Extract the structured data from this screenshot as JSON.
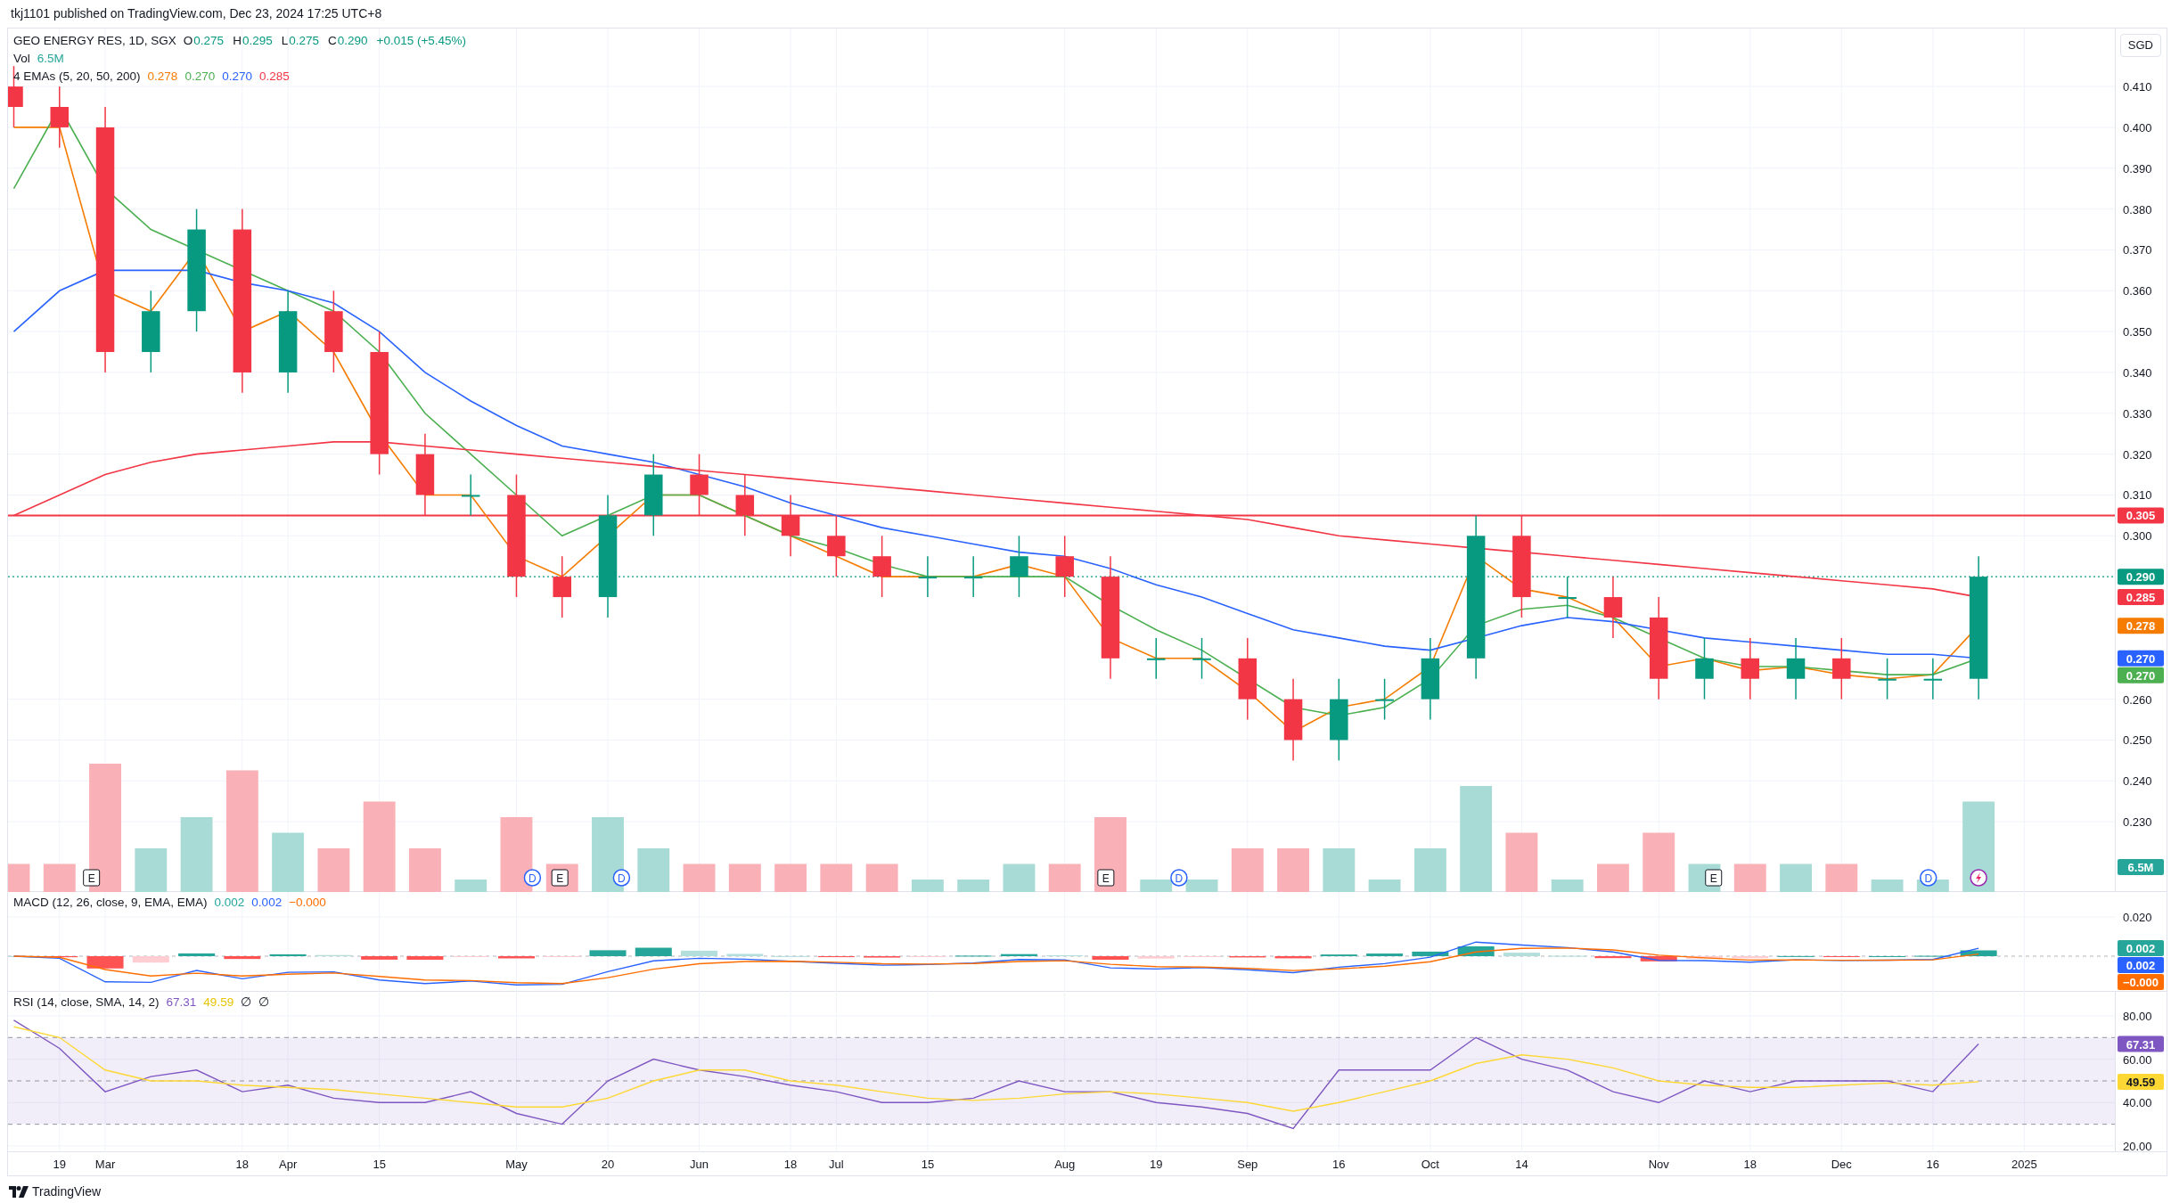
{
  "header": {
    "text": "tkj1101 published on TradingView.com, Dec 23, 2024 17:25 UTC+8"
  },
  "currency_button": "SGD",
  "legend": {
    "symbol": "GEO ENERGY RES, 1D, SGX",
    "ohlc": [
      {
        "key": "O",
        "value": "0.275"
      },
      {
        "key": "H",
        "value": "0.295"
      },
      {
        "key": "L",
        "value": "0.275"
      },
      {
        "key": "C",
        "value": "0.290"
      }
    ],
    "change": "+0.015 (+5.45%)",
    "volume_label": "Vol",
    "volume_value": "6.5M",
    "ema_label": "4 EMAs (5, 20, 50, 200)",
    "ema_values": [
      {
        "text": "0.278",
        "color": "#f57c00"
      },
      {
        "text": "0.270",
        "color": "#4caf50"
      },
      {
        "text": "0.270",
        "color": "#2962ff"
      },
      {
        "text": "0.285",
        "color": "#f23645"
      }
    ]
  },
  "price_pane": {
    "axis_ticks": [
      "0.410",
      "0.400",
      "0.390",
      "0.380",
      "0.370",
      "0.360",
      "0.350",
      "0.340",
      "0.330",
      "0.320",
      "0.310",
      "0.300",
      "0.260",
      "0.250",
      "0.240",
      "0.230"
    ],
    "badges": [
      {
        "text": "0.305",
        "color": "#f23645"
      },
      {
        "text": "0.290",
        "color": "#089981"
      },
      {
        "text": "0.285",
        "color": "#f23645"
      },
      {
        "text": "0.278",
        "color": "#f57c00"
      },
      {
        "text": "0.270",
        "color": "#2962ff"
      },
      {
        "text": "0.270",
        "color": "#4caf50"
      }
    ]
  },
  "events": [
    {
      "kind": "earnings",
      "label": "E"
    },
    {
      "kind": "dividend",
      "label": "D"
    },
    {
      "kind": "earnings",
      "label": "E"
    },
    {
      "kind": "dividend",
      "label": "D"
    },
    {
      "kind": "earnings",
      "label": "E"
    },
    {
      "kind": "dividend",
      "label": "D"
    },
    {
      "kind": "earnings",
      "label": "E"
    },
    {
      "kind": "dividend",
      "label": "D"
    },
    {
      "kind": "news"
    }
  ],
  "volume": {
    "badge": "6.5M"
  },
  "macd": {
    "legend": "MACD (12, 26, close, 9, EMA, EMA)",
    "values": [
      {
        "text": "0.002",
        "color": "#26a69a"
      },
      {
        "text": "0.002",
        "color": "#2962ff"
      },
      {
        "text": "−0.000",
        "color": "#ff6d00"
      }
    ],
    "axis_ticks": [
      "0.020"
    ],
    "badges": [
      {
        "text": "0.002",
        "color": "#26a69a"
      },
      {
        "text": "0.002",
        "color": "#2962ff"
      },
      {
        "text": "−0.000",
        "color": "#ff6d00"
      }
    ]
  },
  "rsi": {
    "legend": "RSI (14, close, SMA, 14, 2)",
    "values": [
      {
        "text": "67.31",
        "color": "#7e57c2"
      },
      {
        "text": "49.59",
        "color": "#e8c400"
      },
      {
        "text": "∅"
      },
      {
        "text": "∅"
      }
    ],
    "chart_data": {
      "type": "line",
      "grid": true,
      "categories": [
        null,
        "19",
        "Mar",
        null,
        null,
        "18",
        "Apr",
        null,
        "15",
        null,
        null,
        "May",
        null,
        "20",
        null,
        "Jun",
        null,
        "18",
        "Jul",
        null,
        "15",
        null,
        null,
        "Aug",
        null,
        "19",
        null,
        "Sep",
        null,
        "16",
        null,
        "Oct",
        null,
        "14",
        null,
        null,
        "Nov",
        null,
        "18",
        null,
        "Dec",
        null,
        "16",
        null,
        "2025",
        null
      ],
      "ylim": [
        17.1,
        91.1
      ],
      "yticks": [
        {
          "value": 80,
          "label": "80.00"
        },
        {
          "value": 60,
          "label": "60.00"
        },
        {
          "value": 40,
          "label": "40.00"
        },
        {
          "value": 20,
          "label": "20.00"
        }
      ],
      "series": [
        {
          "color": "#7e57c2",
          "values": [
            78,
            65,
            45,
            52,
            55,
            45,
            48,
            42,
            40,
            40,
            45,
            35,
            30,
            50,
            60,
            55,
            52,
            48,
            45,
            40,
            40,
            42,
            50,
            45,
            45,
            40,
            38,
            35,
            28,
            55,
            55,
            55,
            70,
            60,
            55,
            45,
            40,
            50,
            45,
            50,
            50,
            50,
            45,
            67,
            null,
            null
          ]
        },
        {
          "color": "#fdd835",
          "values": [
            75,
            70,
            55,
            50,
            50,
            48,
            47,
            46,
            44,
            42,
            40,
            38,
            38,
            42,
            50,
            55,
            55,
            50,
            48,
            45,
            42,
            41,
            42,
            44,
            45,
            44,
            42,
            40,
            36,
            40,
            45,
            50,
            58,
            62,
            60,
            56,
            50,
            48,
            47,
            47,
            48,
            49,
            48,
            49.6,
            null,
            null
          ]
        }
      ],
      "ref_lines": [
        {
          "axis": "y",
          "value": 70
        },
        {
          "axis": "y",
          "value": 50
        },
        {
          "axis": "y",
          "value": 30
        }
      ],
      "bands": [
        {
          "axis": "y",
          "from": 30,
          "to": 70,
          "color": "#7e57c2"
        }
      ]
    },
    "series_labels": [
      "67.31",
      "49.59"
    ]
  },
  "footer": {
    "brand": "TradingView"
  }
}
